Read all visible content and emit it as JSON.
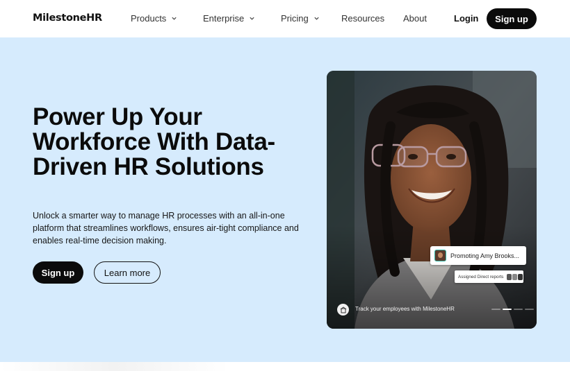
{
  "nav": {
    "logo": "MilestoneHR",
    "items": [
      {
        "label": "Products",
        "dropdown": true
      },
      {
        "label": "Enterprise",
        "dropdown": true
      },
      {
        "label": "Pricing",
        "dropdown": true
      },
      {
        "label": "Resources",
        "dropdown": false
      },
      {
        "label": "About",
        "dropdown": false
      }
    ],
    "login": "Login",
    "signup": "Sign up"
  },
  "hero": {
    "headline": "Power Up Your Workforce With Data-Driven HR Solutions",
    "subcopy": "Unlock a smarter way to manage HR processes with an all-in-one platform that streamlines workflows, ensures air-tight compliance and enables real-time decision making.",
    "primary_cta": "Sign up",
    "secondary_cta": "Learn more"
  },
  "photo_card": {
    "promo_text": "Promoting Amy Brooks...",
    "reports_text": "Assigned Direct reports",
    "track_text": "Track your employees with MilestoneHR",
    "carousel_active_index": 1,
    "carousel_count": 4
  },
  "colors": {
    "hero_bg": "#d6ebfd",
    "primary": "#0b0b0b",
    "accent_teal": "#2fb6a6"
  },
  "icons": {
    "chevron": "chevron-down-icon",
    "track": "building-icon"
  }
}
